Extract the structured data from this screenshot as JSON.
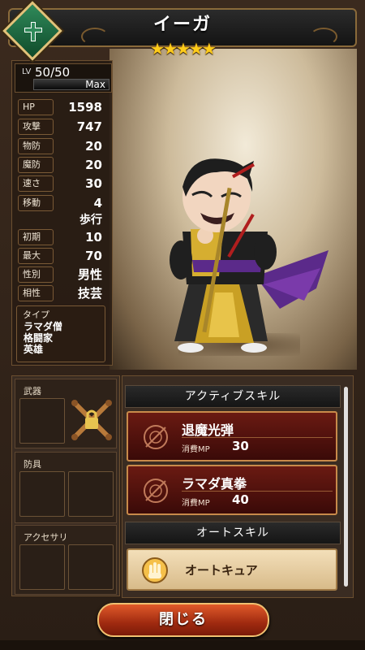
{
  "header": {
    "title": "イーガ",
    "stars": "★★★★★",
    "emblem_icon": "cross-emblem-icon"
  },
  "stats": {
    "level_label": "LV",
    "level_value": "50/50",
    "max_label": "Max",
    "rows": [
      {
        "label": "HP",
        "value": "1598"
      },
      {
        "label": "攻撃",
        "value": "747"
      },
      {
        "label": "物防",
        "value": "20"
      },
      {
        "label": "魔防",
        "value": "20"
      },
      {
        "label": "速さ",
        "value": "30"
      },
      {
        "label": "移動",
        "value": "4",
        "value2": "歩行"
      },
      {
        "label": "初期MP",
        "value": "10"
      },
      {
        "label": "最大MP",
        "value": "70"
      },
      {
        "label": "性別",
        "value": "男性"
      },
      {
        "label": "相性",
        "value": "技芸"
      }
    ],
    "type_label": "タイプ",
    "types": [
      "ラマダ僧",
      "格闘家",
      "英雄"
    ]
  },
  "equipment": {
    "weapon_label": "武器",
    "armor_label": "防具",
    "accessory_label": "アクセサリ"
  },
  "skills": {
    "active_header": "アクティブスキル",
    "active": [
      {
        "name": "退魔光弾",
        "mp_label": "消費MP",
        "mp": "30"
      },
      {
        "name": "ラマダ真拳",
        "mp_label": "消費MP",
        "mp": "40"
      }
    ],
    "auto_header": "オートスキル",
    "auto": [
      {
        "name": "オートキュア",
        "icon": "hand-cure-icon"
      }
    ]
  },
  "close_button": "閉じる",
  "colors": {
    "accent_gold": "#ffcc1a",
    "skill_card": "#6a1a12",
    "close_button": "#e05a2a"
  }
}
